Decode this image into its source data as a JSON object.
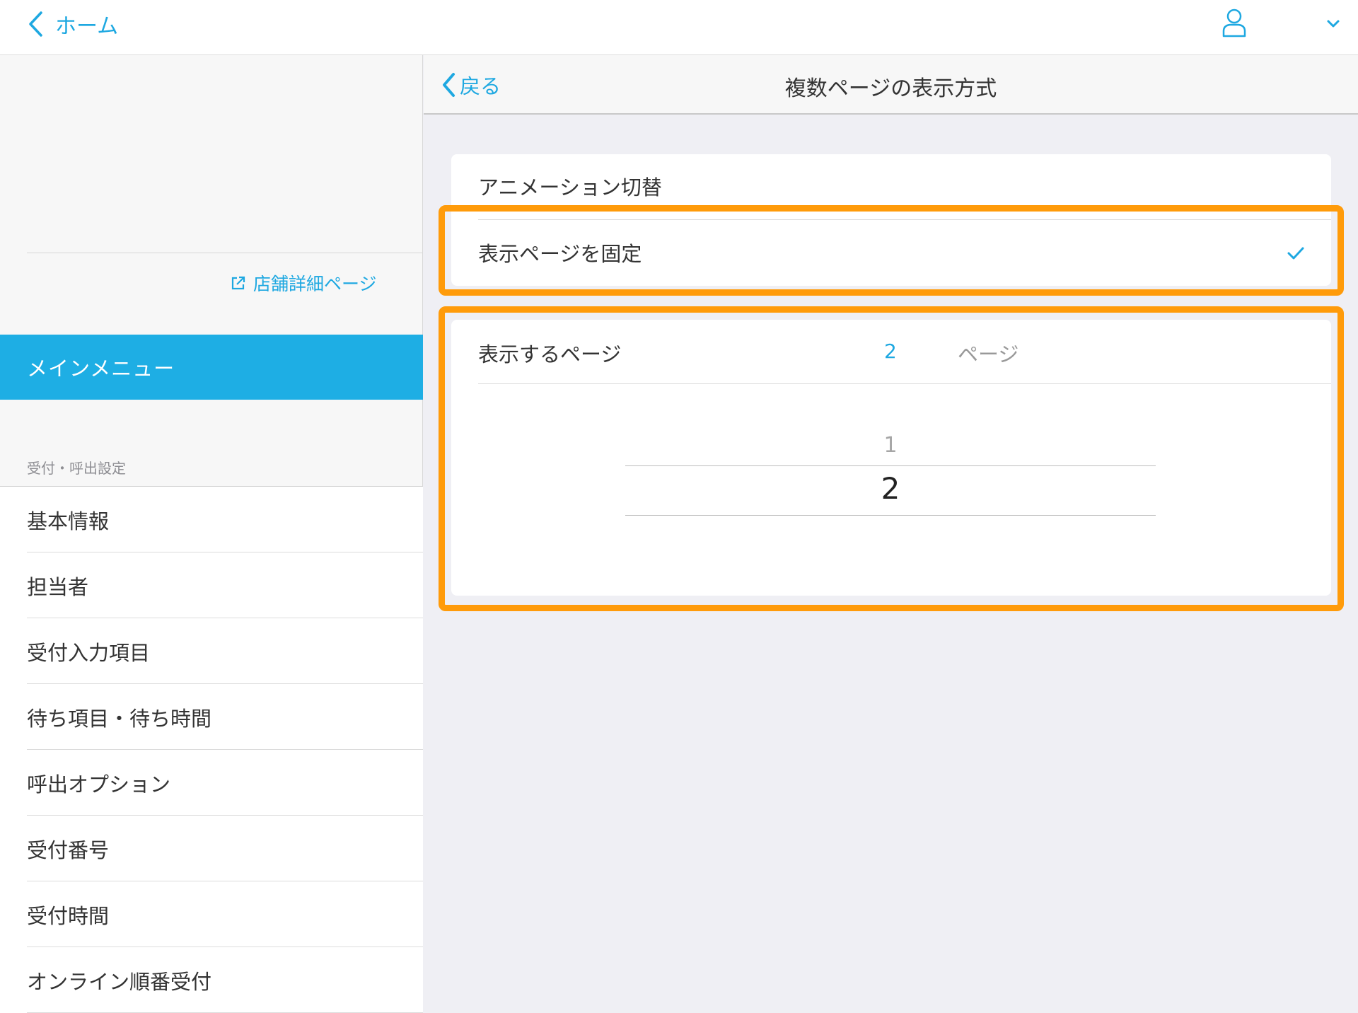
{
  "topbar": {
    "home_label": "ホーム",
    "icons": {
      "back": "chevron-left-icon",
      "user": "user-icon",
      "menu": "chevron-down-icon"
    }
  },
  "sidebar": {
    "store_link": "店舗詳細ページ",
    "main_menu": "メインメニュー",
    "section_label": "受付・呼出設定",
    "items": [
      "基本情報",
      "担当者",
      "受付入力項目",
      "待ち項目・待ち時間",
      "呼出オプション",
      "受付番号",
      "受付時間",
      "オンライン順番受付"
    ]
  },
  "navbar": {
    "back_label": "戻る",
    "title": "複数ページの表示方式"
  },
  "options": [
    {
      "label": "アニメーション切替",
      "selected": false
    },
    {
      "label": "表示ページを固定",
      "selected": true
    }
  ],
  "page_setting": {
    "label": "表示するページ",
    "value": "2",
    "unit": "ページ",
    "picker_options": [
      "1",
      "2"
    ],
    "picker_selected": "2"
  },
  "colors": {
    "accent": "#1ea8e1",
    "highlight": "#ff9b0a",
    "main_menu_bg": "#1eaee4"
  }
}
